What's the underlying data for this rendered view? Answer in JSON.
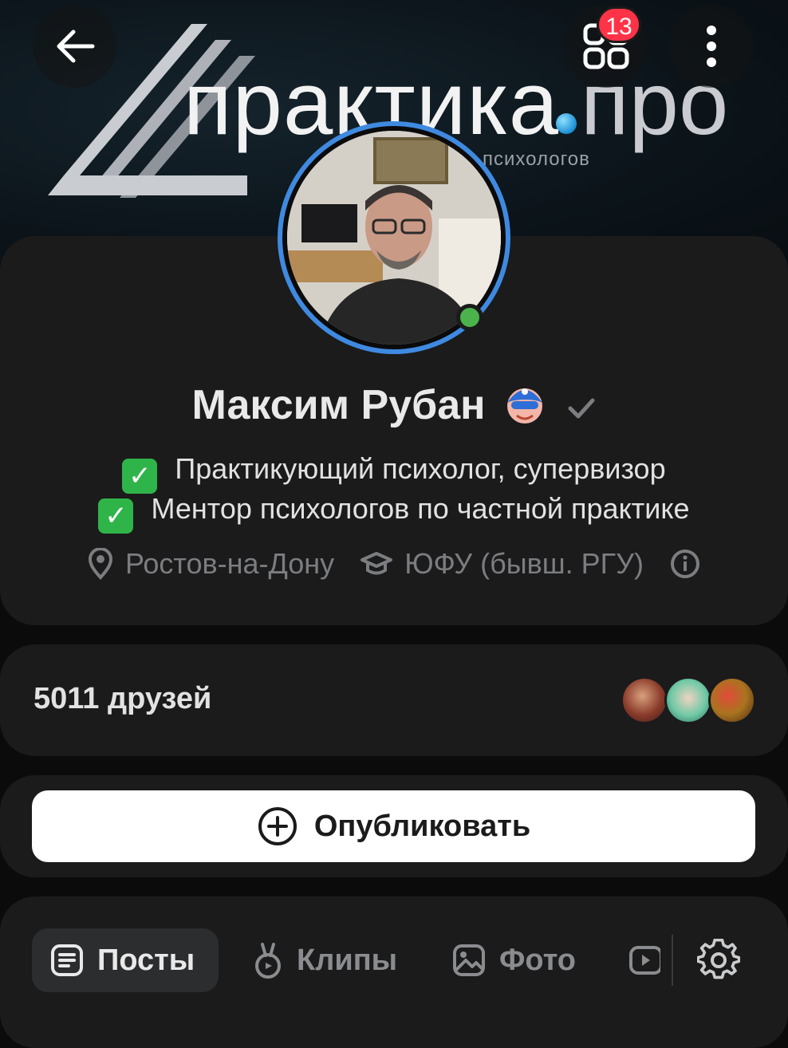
{
  "cover": {
    "logo_main": "практика",
    "logo_pro": "про",
    "logo_subtitle": "психологов"
  },
  "header": {
    "back_icon": "arrow-left-icon",
    "apps_icon": "apps-grid-icon",
    "notification_count": "13",
    "more_icon": "more-vertical-icon"
  },
  "profile": {
    "name": "Максим Рубан",
    "emoji_icon": "superhero-emoji-icon",
    "verified_icon": "checkmark-icon",
    "status_lines": [
      "Практикующий психолог, супервизор",
      "Ментор психологов по частной практике"
    ],
    "city": "Ростов-на-Дону",
    "education": "ЮФУ (бывш. РГУ)",
    "online": true
  },
  "friends": {
    "label": "5011 друзей"
  },
  "publish": {
    "label": "Опубликовать"
  },
  "tabs": [
    {
      "label": "Посты",
      "icon": "posts-icon",
      "active": true
    },
    {
      "label": "Клипы",
      "icon": "clips-icon",
      "active": false
    },
    {
      "label": "Фото",
      "icon": "photo-icon",
      "active": false
    },
    {
      "label": "",
      "icon": "video-icon",
      "active": false
    }
  ],
  "colors": {
    "accent": "#3f8ae0",
    "online": "#4bb34b",
    "badge": "#ff3347",
    "check": "#2fb449"
  }
}
